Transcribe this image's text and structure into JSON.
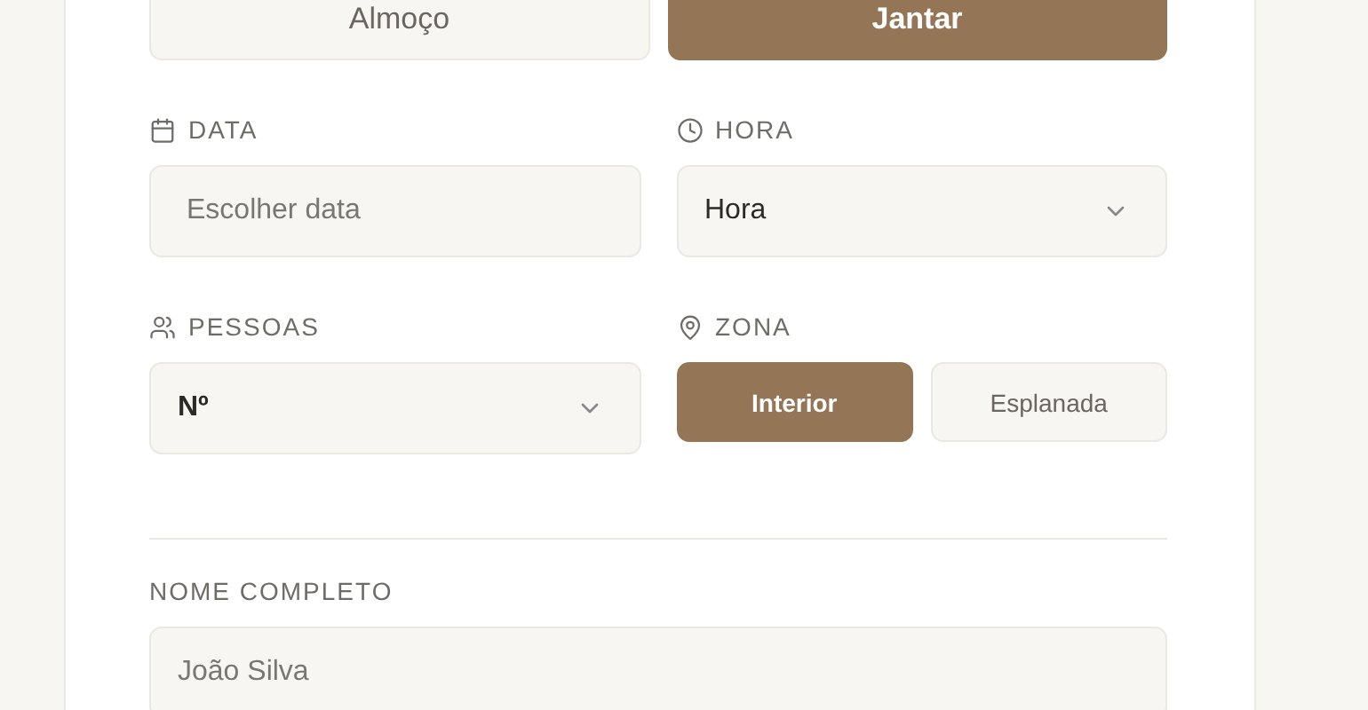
{
  "meal_options": [
    {
      "label": "Almoço",
      "selected": false
    },
    {
      "label": "Jantar",
      "selected": true
    }
  ],
  "date": {
    "label": "DATA",
    "placeholder": "Escolher data"
  },
  "time": {
    "label": "HORA",
    "value": "Hora"
  },
  "people": {
    "label": "PESSOAS",
    "value": "Nº"
  },
  "zone": {
    "label": "ZONA",
    "options": [
      {
        "label": "Interior",
        "selected": true
      },
      {
        "label": "Esplanada",
        "selected": false
      }
    ]
  },
  "full_name": {
    "label": "NOME COMPLETO",
    "placeholder": "João Silva"
  }
}
